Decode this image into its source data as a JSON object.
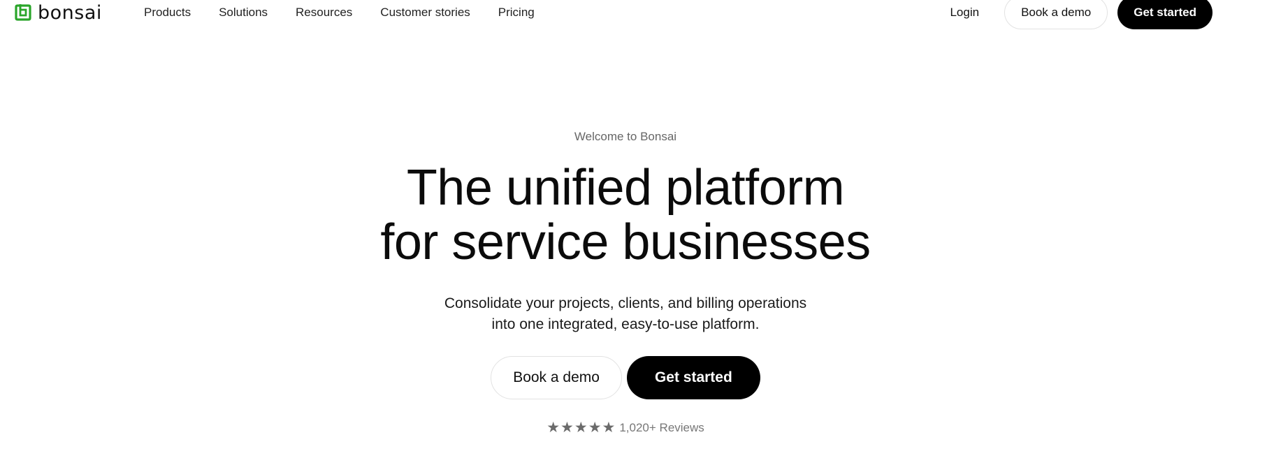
{
  "brand": {
    "name": "bonsai",
    "accent_color": "#2aa52a"
  },
  "nav": {
    "items": [
      {
        "label": "Products"
      },
      {
        "label": "Solutions"
      },
      {
        "label": "Resources"
      },
      {
        "label": "Customer stories"
      },
      {
        "label": "Pricing"
      }
    ]
  },
  "header_actions": {
    "login_label": "Login",
    "book_demo_label": "Book a demo",
    "get_started_label": "Get started"
  },
  "hero": {
    "eyebrow": "Welcome to Bonsai",
    "headline_line1": "The unified platform",
    "headline_line2": "for service businesses",
    "subcopy_line1": "Consolidate your projects, clients, and billing operations",
    "subcopy_line2": "into one integrated, easy-to-use platform.",
    "book_demo_label": "Book a demo",
    "get_started_label": "Get started"
  },
  "reviews": {
    "rating_stars": 5,
    "star_icon": "star-icon",
    "count_text": "1,020+ Reviews"
  }
}
